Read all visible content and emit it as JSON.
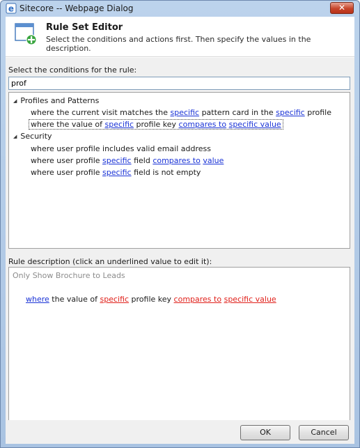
{
  "window": {
    "title": "Sitecore -- Webpage Dialog",
    "close_glyph": "✕"
  },
  "header": {
    "title": "Rule Set Editor",
    "subtitle": "Select the conditions and actions first. Then specify the values in the description.",
    "icon": "rule-editor-add-icon"
  },
  "conditions_section": {
    "label": "Select the conditions for the rule:",
    "search_value": "prof",
    "groups": [
      {
        "name": "Profiles and Patterns",
        "items": [
          {
            "pre": "where the current visit matches the ",
            "l1": "specific",
            "mid": " pattern card in the ",
            "l2": "specific",
            "post": " profile"
          },
          {
            "pre": "where the value of ",
            "l1": "specific",
            "mid": " profile key ",
            "l2": "compares to",
            "sp": " ",
            "l3": "specific value"
          }
        ]
      },
      {
        "name": "Security",
        "items": [
          {
            "text": "where user profile includes valid email address"
          },
          {
            "pre": "where user profile ",
            "l1": "specific",
            "mid": " field ",
            "l2": "compares to",
            "sp": " ",
            "l3": "value"
          },
          {
            "pre": "where user profile ",
            "l1": "specific",
            "post": " field is not empty"
          }
        ]
      }
    ]
  },
  "description_section": {
    "label": "Rule description (click an underlined value to edit it):",
    "rule_name": "Only Show Brochure to Leads",
    "line": {
      "l0": "where",
      "pre": " the value of ",
      "l1": "specific",
      "mid": " profile key ",
      "l2": "compares to",
      "sp": " ",
      "l3": "specific value"
    }
  },
  "footer": {
    "ok_label": "OK",
    "cancel_label": "Cancel"
  },
  "colors": {
    "link_blue": "#1a33d6",
    "link_red": "#e0201a",
    "placeholder_gray": "#8c8c8c"
  }
}
